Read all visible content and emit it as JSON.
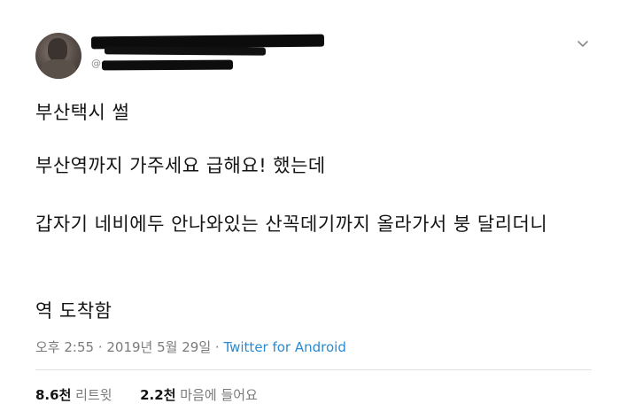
{
  "header": {
    "handle_prefix": "@"
  },
  "tweet": {
    "lines": [
      "부산택시 썰",
      "부산역까지 가주세요 급해요!  했는데",
      "갑자기 네비에두 안나와있는 산꼭데기까지 올라가서 붕 달리더니",
      "역 도착함"
    ]
  },
  "meta": {
    "time": "오후 2:55",
    "separator": " · ",
    "date": "2019년 5월 29일",
    "source": "Twitter for Android"
  },
  "stats": {
    "retweets_count": "8.6천",
    "retweets_label": "리트윗",
    "likes_count": "2.2천",
    "likes_label": "마음에 들어요"
  }
}
